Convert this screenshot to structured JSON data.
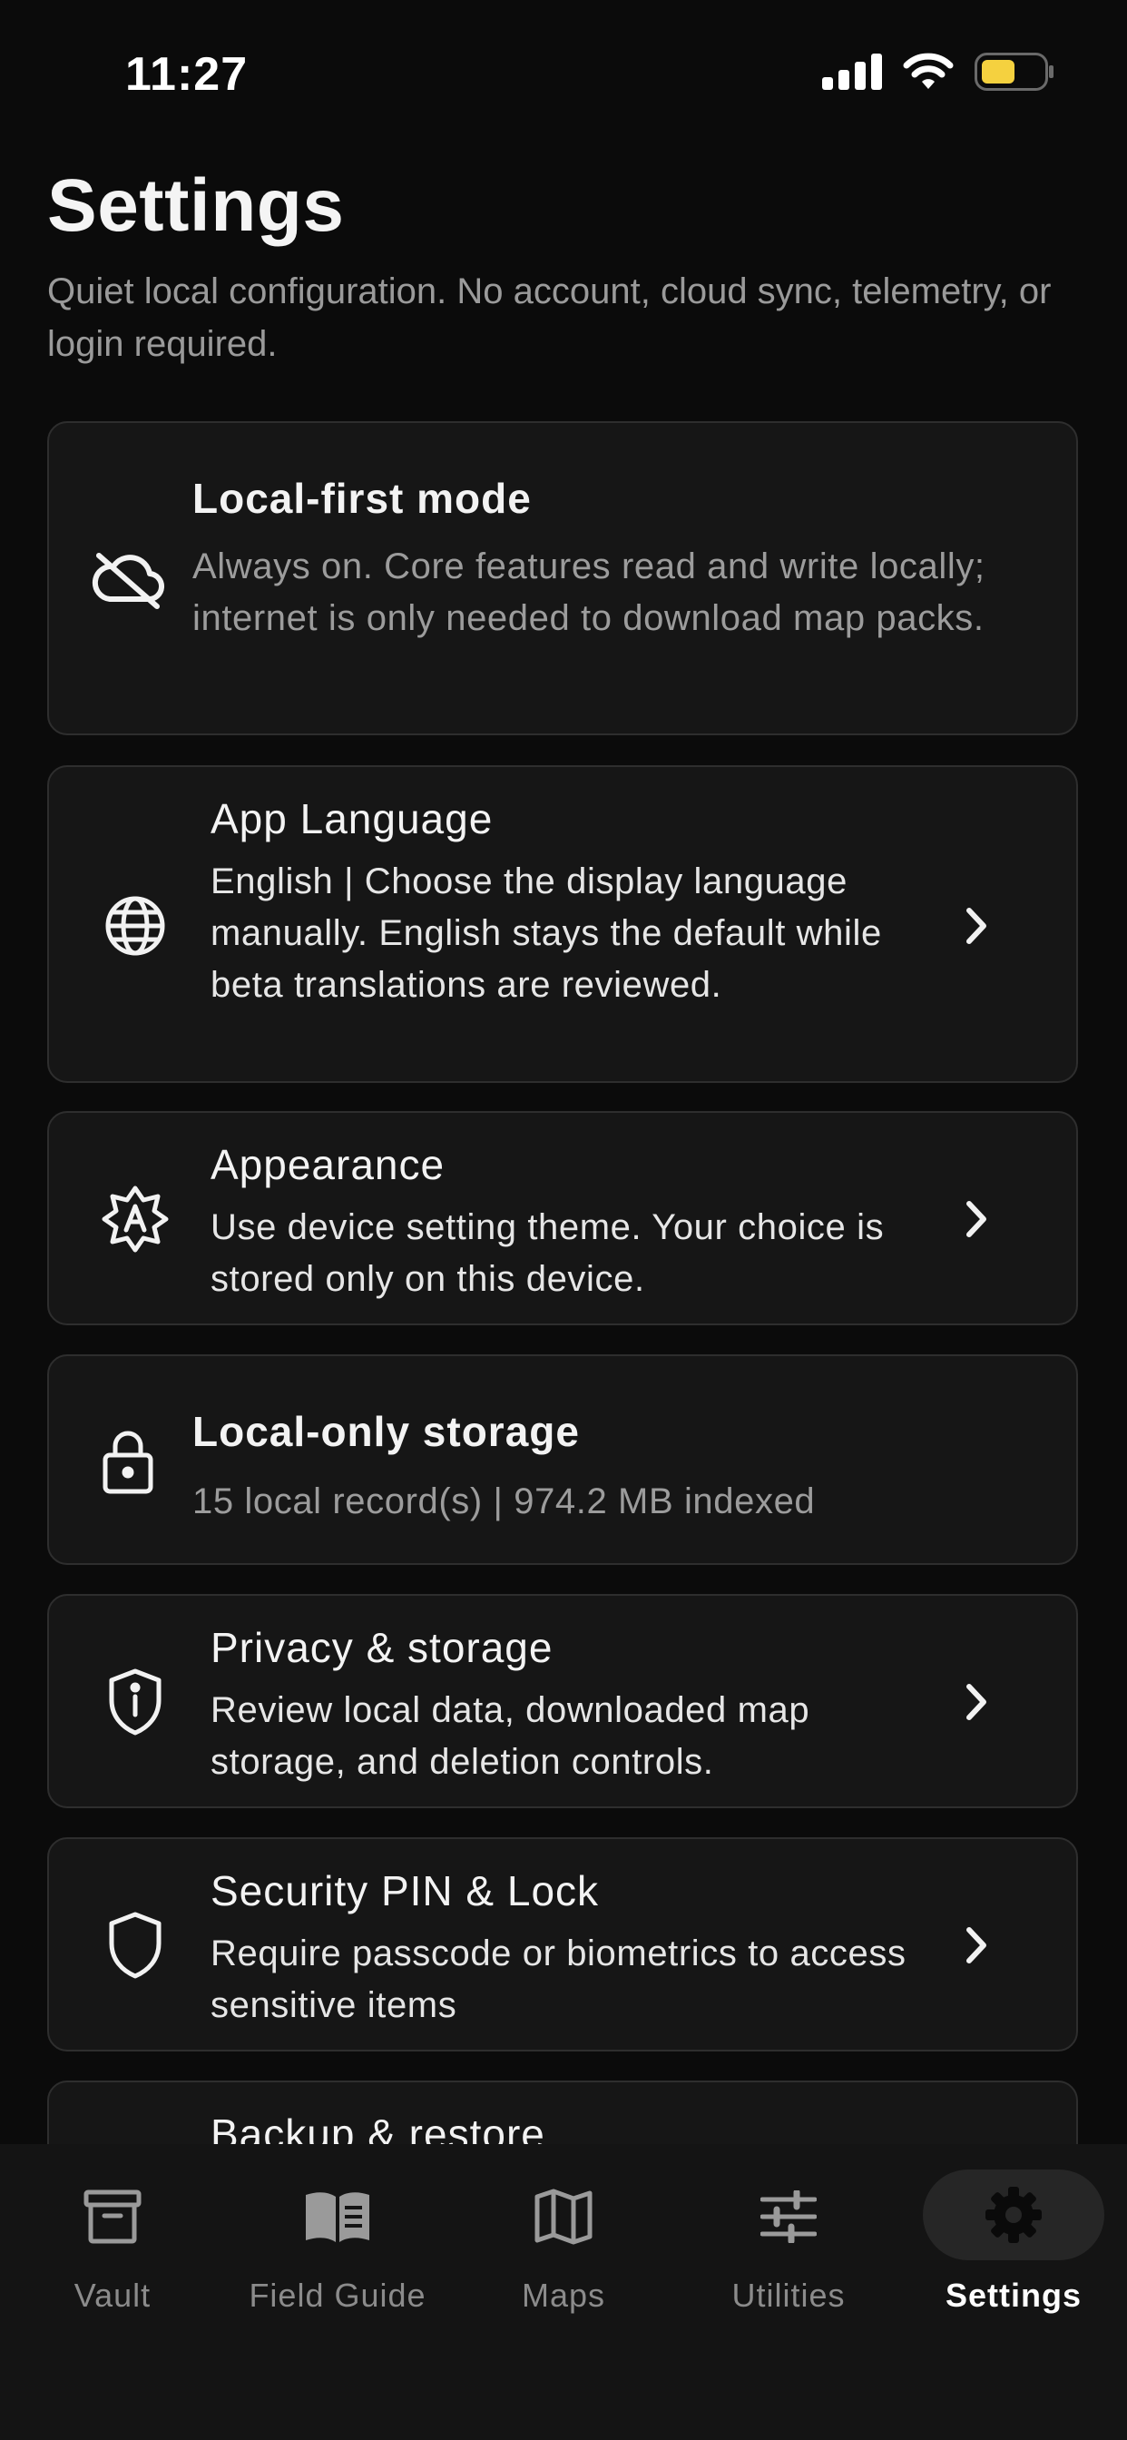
{
  "status_bar": {
    "time": "11:27"
  },
  "header": {
    "title": "Settings",
    "subtitle": "Quiet local configuration. No account, cloud sync, telemetry, or login required."
  },
  "cards": [
    {
      "icon": "cloud-off-icon",
      "title": "Local-first mode",
      "description": "Always on. Core features read and write locally; internet is only needed to download map packs."
    },
    {
      "icon": "globe-icon",
      "title": "App Language",
      "description": "English | Choose the display language manually. English stays the default while beta translations are reviewed."
    },
    {
      "icon": "appearance-icon",
      "title": "Appearance",
      "description": "Use device setting theme. Your choice is stored only on this device."
    },
    {
      "icon": "lock-icon",
      "title": "Local-only storage",
      "description": "15 local record(s) | 974.2 MB indexed"
    },
    {
      "icon": "privacy-shield-icon",
      "title": "Privacy & storage",
      "description": "Review local data, downloaded map storage, and deletion controls."
    },
    {
      "icon": "shield-icon",
      "title": "Security PIN & Lock",
      "description": "Require passcode or biometrics to access sensitive items"
    },
    {
      "icon": "backup-icon",
      "title": "Backup & restore"
    }
  ],
  "tabs": [
    {
      "label": "Vault",
      "icon": "archive-icon",
      "active": false
    },
    {
      "label": "Field Guide",
      "icon": "book-icon",
      "active": false
    },
    {
      "label": "Maps",
      "icon": "map-icon",
      "active": false
    },
    {
      "label": "Utilities",
      "icon": "sliders-icon",
      "active": false
    },
    {
      "label": "Settings",
      "icon": "gear-icon",
      "active": true
    }
  ],
  "colors": {
    "background": "#0b0b0b",
    "card": "#161616",
    "battery": "#f5d13f",
    "muted_text": "#9a9a9a"
  }
}
